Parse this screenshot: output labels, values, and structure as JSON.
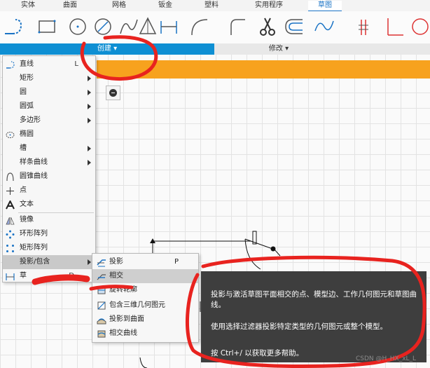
{
  "tabs": [
    "实体",
    "曲面",
    "网格",
    "钣金",
    "塑料",
    "实用程序",
    "草图"
  ],
  "active_tab": "草图",
  "ribbon": {
    "create_label": "创建 ▾",
    "modify_label": "修改 ▾"
  },
  "menu": {
    "items": [
      {
        "label": "直线",
        "shortcut": "L",
        "icon": "line-icon",
        "submenu": false
      },
      {
        "label": "矩形",
        "shortcut": "",
        "icon": "",
        "submenu": true
      },
      {
        "label": "圆",
        "shortcut": "",
        "icon": "",
        "submenu": true
      },
      {
        "label": "圆弧",
        "shortcut": "",
        "icon": "",
        "submenu": true
      },
      {
        "label": "多边形",
        "shortcut": "",
        "icon": "",
        "submenu": true
      },
      {
        "label": "椭圆",
        "shortcut": "",
        "icon": "ellipse-icon",
        "submenu": false
      },
      {
        "label": "槽",
        "shortcut": "",
        "icon": "",
        "submenu": true
      },
      {
        "label": "样条曲线",
        "shortcut": "",
        "icon": "",
        "submenu": true
      },
      {
        "label": "圆锥曲线",
        "shortcut": "",
        "icon": "conic-curve-icon",
        "submenu": false
      },
      {
        "label": "点",
        "shortcut": "",
        "icon": "point-icon",
        "submenu": false
      },
      {
        "label": "文本",
        "shortcut": "",
        "icon": "text-icon",
        "submenu": false
      },
      {
        "label": "镜像",
        "shortcut": "",
        "icon": "mirror-icon",
        "submenu": false
      },
      {
        "label": "环形阵列",
        "shortcut": "",
        "icon": "circular-pattern-icon",
        "submenu": false
      },
      {
        "label": "矩形阵列",
        "shortcut": "",
        "icon": "rectangular-pattern-icon",
        "submenu": false
      },
      {
        "label": "投影/包含",
        "shortcut": "",
        "icon": "",
        "submenu": true
      },
      {
        "label": "草",
        "shortcut": "D",
        "icon": "sketch-dimension-icon",
        "submenu": false
      }
    ]
  },
  "submenu": {
    "items": [
      {
        "label": "投影",
        "shortcut": "P",
        "icon": "project-icon"
      },
      {
        "label": "相交",
        "shortcut": "",
        "icon": "intersect-icon"
      },
      {
        "label": "旋转轮廓",
        "shortcut": "",
        "icon": "rotate-profile-icon"
      },
      {
        "label": "包含三维几何图元",
        "shortcut": "",
        "icon": "include-3d-geometry-icon"
      },
      {
        "label": "投影到曲面",
        "shortcut": "",
        "icon": "project-to-surface-icon"
      },
      {
        "label": "相交曲线",
        "shortcut": "",
        "icon": "intersection-curve-icon"
      }
    ]
  },
  "tooltip": {
    "line1": "投影与激活草图平面相交的点、模型边、工作几何图元和草图曲线。",
    "line2": "使用选择过滤器投影特定类型的几何图元或整个模型。",
    "line3": "按 Ctrl+/ 以获取更多帮助。"
  },
  "watermark": "CSDN @H_HX_xL_L",
  "colors": {
    "accent": "#0e8fd3",
    "banner": "#f7a21e",
    "annotation": "#e8231f",
    "tooltip_bg": "#3e3e3e"
  }
}
